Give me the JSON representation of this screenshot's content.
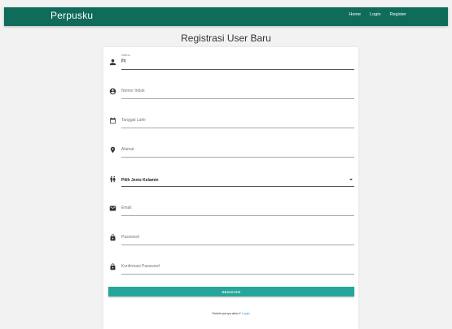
{
  "navbar": {
    "brand": "Perpusku",
    "links": [
      "Home",
      "Login",
      "Register"
    ]
  },
  "page": {
    "title": "Registrasi User Baru"
  },
  "form": {
    "nama": {
      "label": "Nama",
      "value": "jhj"
    },
    "nomor_induk": {
      "placeholder": "Nomor Induk"
    },
    "tanggal_lahir": {
      "placeholder": "Tanggal Lahir"
    },
    "alamat": {
      "placeholder": "Alamat"
    },
    "jenis_kelamin": {
      "selected": "Pilih Jenis Kelamin"
    },
    "email": {
      "placeholder": "Email"
    },
    "password": {
      "placeholder": "Password"
    },
    "konfirmasi_password": {
      "placeholder": "Konfirmasi Password"
    },
    "register_button": "REGISTER",
    "login_hint": "Sudah punya akun?",
    "login_link": "Login"
  },
  "icons": {
    "nama": "person-icon",
    "nomor_induk": "account-circle-icon",
    "tanggal_lahir": "calendar-icon",
    "alamat": "location-pin-icon",
    "jenis_kelamin": "wc-icon",
    "email": "mail-icon",
    "password": "lock-icon",
    "konfirmasi_password": "lock-icon"
  },
  "colors": {
    "navbar": "#0f6b5a",
    "button": "#26a69a",
    "link": "#2196f3"
  }
}
